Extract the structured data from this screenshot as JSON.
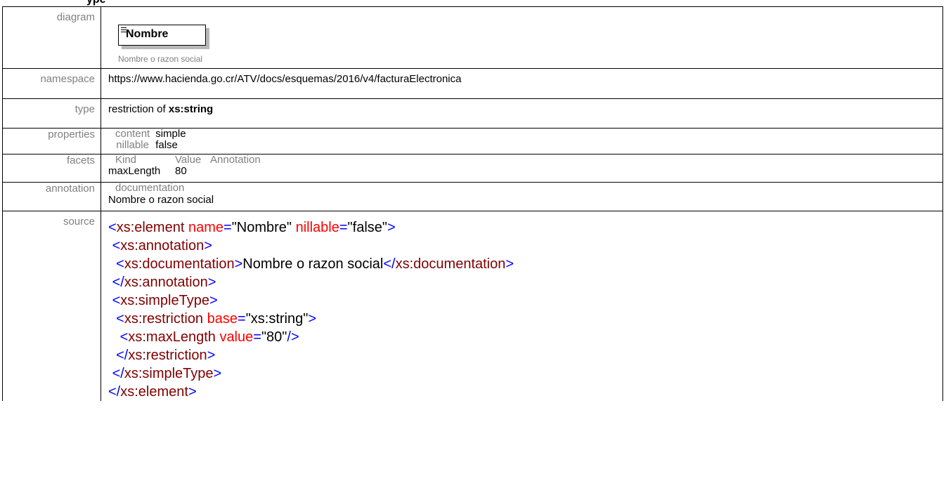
{
  "heading_fragment": "ype",
  "rows": {
    "diagram": {
      "label": "diagram",
      "element_name": "Nombre",
      "element_doc": "Nombre o razon social"
    },
    "namespace": {
      "label": "namespace",
      "value": "https://www.hacienda.go.cr/ATV/docs/esquemas/2016/v4/facturaElectronica"
    },
    "type": {
      "label": "type",
      "prefix": "restriction of ",
      "base": "xs:string"
    },
    "properties": {
      "label": "properties",
      "items": [
        {
          "key": "content",
          "value": "simple"
        },
        {
          "key": "nillable",
          "value": "false"
        }
      ]
    },
    "facets": {
      "label": "facets",
      "headers": [
        "Kind",
        "Value",
        "Annotation"
      ],
      "rows": [
        {
          "kind": "maxLength",
          "value": "80",
          "annotation": ""
        }
      ]
    },
    "annotation": {
      "label": "annotation",
      "key": "documentation",
      "value": "Nombre o razon social"
    },
    "source": {
      "label": "source",
      "lines": [
        {
          "indent": "",
          "parts": [
            [
              "t",
              "<"
            ],
            [
              "n",
              "xs:element"
            ],
            [
              "s",
              " "
            ],
            [
              "a",
              "name"
            ],
            [
              "t",
              "="
            ],
            [
              "s",
              "\"Nombre\""
            ],
            [
              "s",
              " "
            ],
            [
              "a",
              "nillable"
            ],
            [
              "t",
              "="
            ],
            [
              "s",
              "\"false\""
            ],
            [
              "t",
              ">"
            ]
          ]
        },
        {
          "indent": " ",
          "parts": [
            [
              "t",
              "<"
            ],
            [
              "n",
              "xs:annotation"
            ],
            [
              "t",
              ">"
            ]
          ]
        },
        {
          "indent": "  ",
          "parts": [
            [
              "t",
              "<"
            ],
            [
              "n",
              "xs:documentation"
            ],
            [
              "t",
              ">"
            ],
            [
              "x",
              "Nombre o razon social"
            ],
            [
              "t",
              "</"
            ],
            [
              "n",
              "xs:documentation"
            ],
            [
              "t",
              ">"
            ]
          ]
        },
        {
          "indent": " ",
          "parts": [
            [
              "t",
              "</"
            ],
            [
              "n",
              "xs:annotation"
            ],
            [
              "t",
              ">"
            ]
          ]
        },
        {
          "indent": " ",
          "parts": [
            [
              "t",
              "<"
            ],
            [
              "n",
              "xs:simpleType"
            ],
            [
              "t",
              ">"
            ]
          ]
        },
        {
          "indent": "  ",
          "parts": [
            [
              "t",
              "<"
            ],
            [
              "n",
              "xs:restriction"
            ],
            [
              "s",
              " "
            ],
            [
              "a",
              "base"
            ],
            [
              "t",
              "="
            ],
            [
              "s",
              "\"xs:string\""
            ],
            [
              "t",
              ">"
            ]
          ]
        },
        {
          "indent": "   ",
          "parts": [
            [
              "t",
              "<"
            ],
            [
              "n",
              "xs:maxLength"
            ],
            [
              "s",
              " "
            ],
            [
              "a",
              "value"
            ],
            [
              "t",
              "="
            ],
            [
              "s",
              "\"80\""
            ],
            [
              "t",
              "/>"
            ]
          ]
        },
        {
          "indent": "  ",
          "parts": [
            [
              "t",
              "</"
            ],
            [
              "n",
              "xs:restriction"
            ],
            [
              "t",
              ">"
            ]
          ]
        },
        {
          "indent": " ",
          "parts": [
            [
              "t",
              "</"
            ],
            [
              "n",
              "xs:simpleType"
            ],
            [
              "t",
              ">"
            ]
          ]
        },
        {
          "indent": "",
          "parts": [
            [
              "t",
              "</"
            ],
            [
              "n",
              "xs:element"
            ],
            [
              "t",
              ">"
            ]
          ]
        }
      ]
    }
  }
}
